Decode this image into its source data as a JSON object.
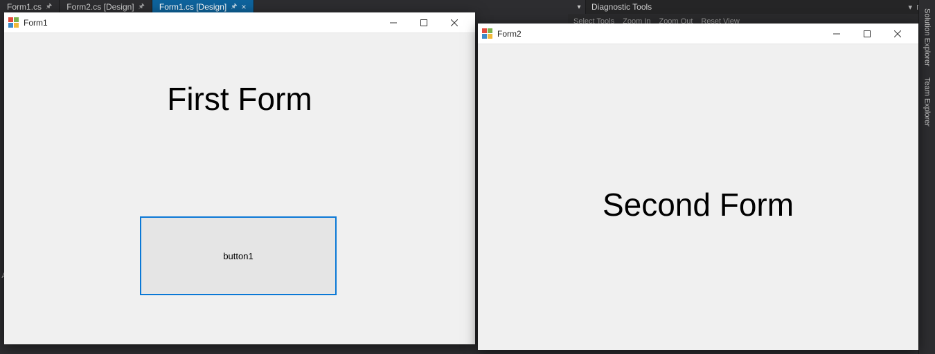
{
  "ide": {
    "tabs": [
      {
        "label": "Form1.cs",
        "pinned": true,
        "active": false
      },
      {
        "label": "Form2.cs [Design]",
        "pinned": true,
        "active": false
      },
      {
        "label": "Form1.cs [Design]",
        "pinned": true,
        "active": true
      }
    ],
    "diagnostic_tools_title": "Diagnostic Tools",
    "diag_toolbar_items": [
      "Select Tools",
      "Zoom In",
      "Zoom Out",
      "Reset View"
    ],
    "right_tabs": [
      "Solution Explorer",
      "Team Explorer"
    ],
    "left_fragment_text": "A"
  },
  "form1": {
    "title": "Form1",
    "heading": "First Form",
    "button1_text": "button1"
  },
  "form2": {
    "title": "Form2",
    "heading": "Second Form"
  }
}
